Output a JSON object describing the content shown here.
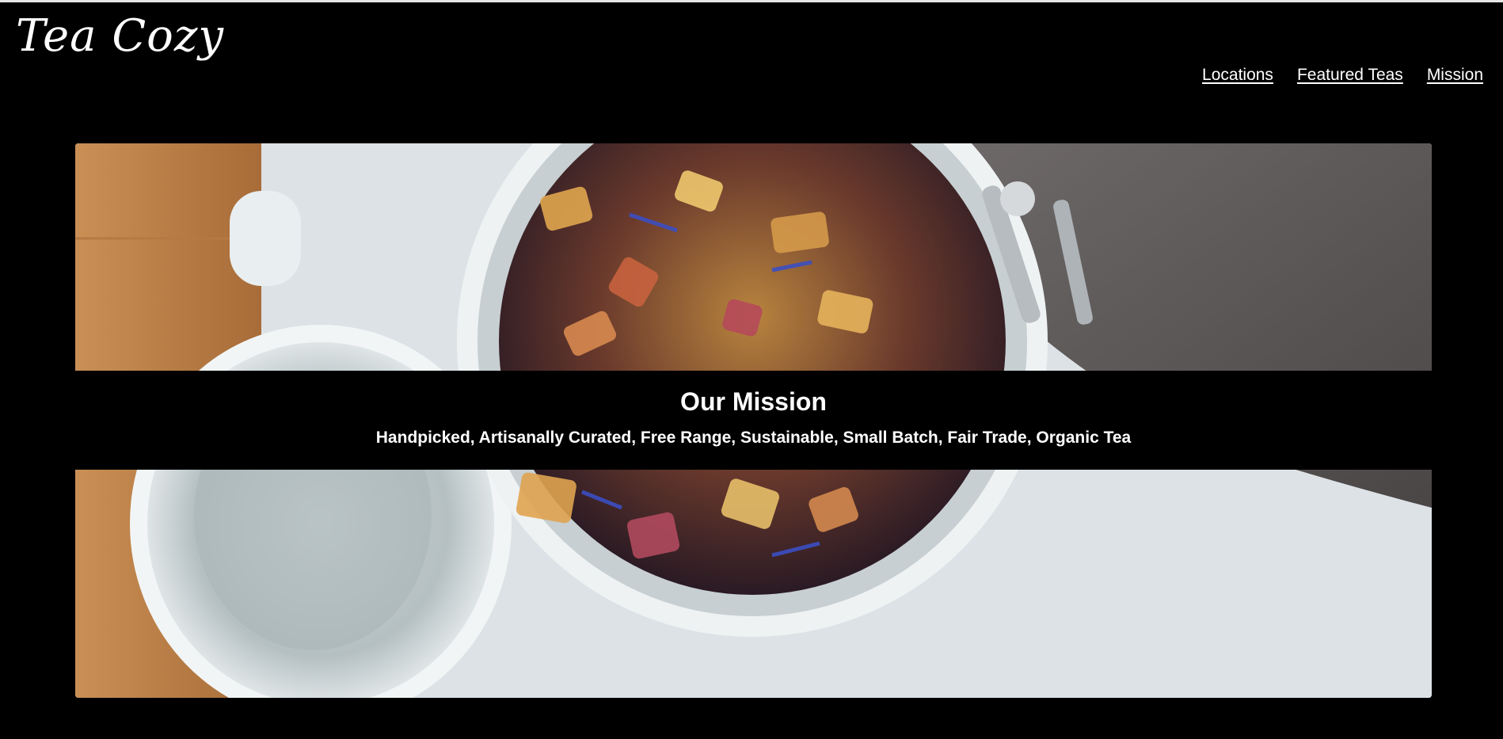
{
  "brand": {
    "logo_text": "Tea Cozy"
  },
  "nav": {
    "items": [
      {
        "label": "Locations"
      },
      {
        "label": "Featured Teas"
      },
      {
        "label": "Mission"
      }
    ]
  },
  "hero": {
    "image_subject": "open glass jar of loose leaf fruit tea",
    "title": "Our Mission",
    "tagline": "Handpicked, Artisanally Curated, Free Range, Sustainable, Small Batch, Fair Trade, Organic Tea"
  },
  "colors": {
    "background": "#000000",
    "text": "#ffffff",
    "top_border": "#e6e6e6"
  }
}
